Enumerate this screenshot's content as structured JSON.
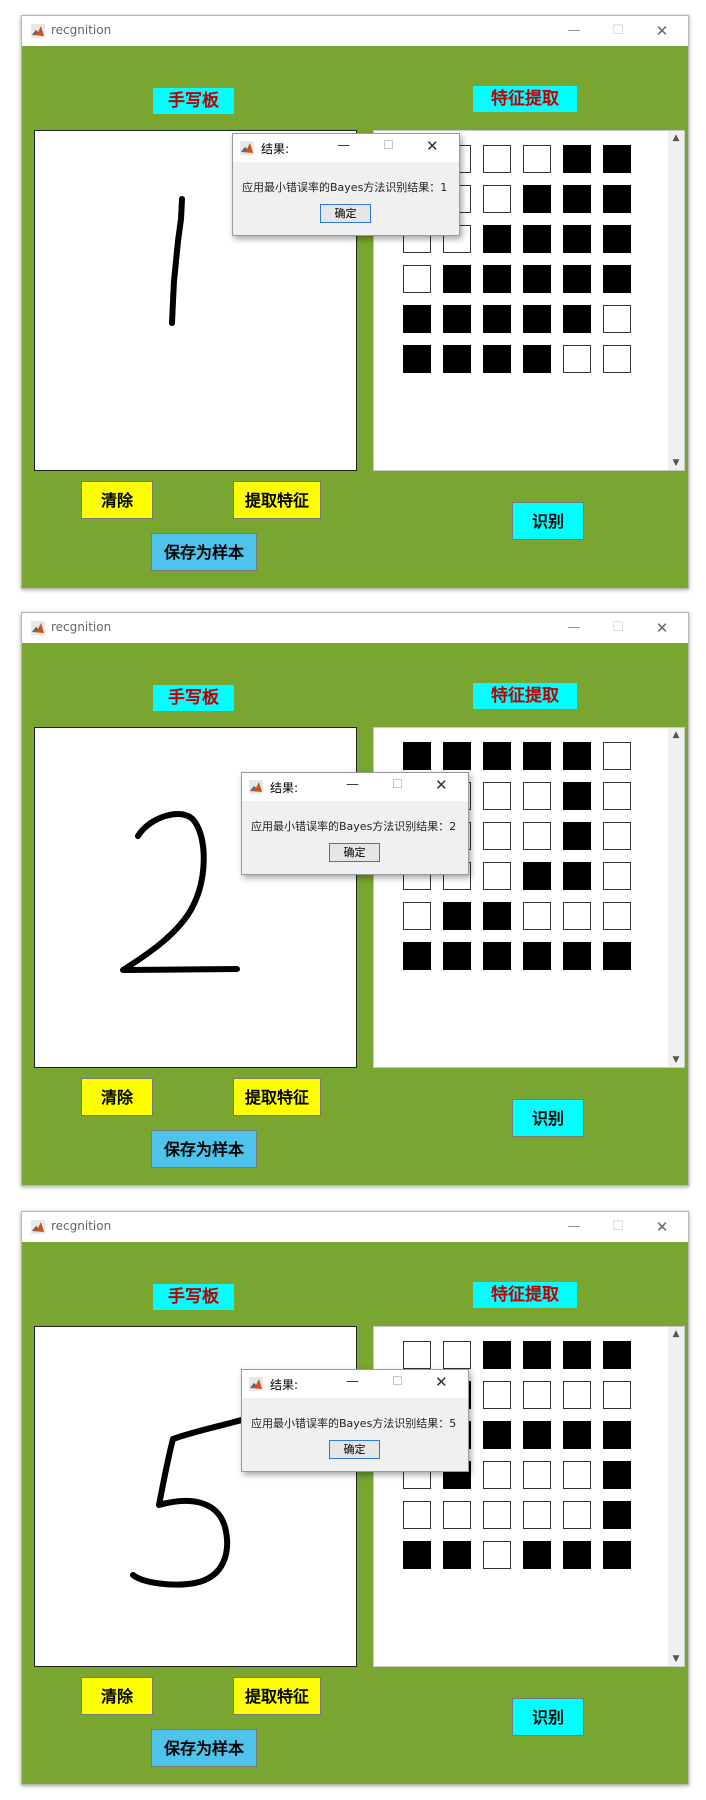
{
  "windows": [
    {
      "title": "recgnition",
      "handwriting_label": "手写板",
      "feature_label": "特征提取",
      "buttons": {
        "clear": "清除",
        "extract": "提取特征",
        "save": "保存为样本",
        "recognize": "识别"
      },
      "dialog": {
        "title": "结果:",
        "message": "应用最小错误率的Bayes方法识别结果：1",
        "ok": "确定"
      },
      "digit": "1",
      "features": [
        [
          0,
          0,
          0,
          0,
          1,
          1
        ],
        [
          0,
          0,
          0,
          1,
          1,
          1
        ],
        [
          0,
          0,
          1,
          1,
          1,
          1
        ],
        [
          0,
          1,
          1,
          1,
          1,
          1
        ],
        [
          1,
          1,
          1,
          1,
          1,
          0
        ],
        [
          1,
          1,
          1,
          1,
          0,
          0
        ]
      ]
    },
    {
      "title": "recgnition",
      "handwriting_label": "手写板",
      "feature_label": "特征提取",
      "buttons": {
        "clear": "清除",
        "extract": "提取特征",
        "save": "保存为样本",
        "recognize": "识别"
      },
      "dialog": {
        "title": "结果:",
        "message": "应用最小错误率的Bayes方法识别结果：2",
        "ok": "确定"
      },
      "digit": "2",
      "features": [
        [
          1,
          1,
          1,
          1,
          1,
          0
        ],
        [
          0,
          0,
          0,
          0,
          1,
          0
        ],
        [
          0,
          0,
          0,
          0,
          1,
          0
        ],
        [
          0,
          0,
          0,
          1,
          1,
          0
        ],
        [
          0,
          1,
          1,
          0,
          0,
          0
        ],
        [
          1,
          1,
          1,
          1,
          1,
          1
        ]
      ]
    },
    {
      "title": "recgnition",
      "handwriting_label": "手写板",
      "feature_label": "特征提取",
      "buttons": {
        "clear": "清除",
        "extract": "提取特征",
        "save": "保存为样本",
        "recognize": "识别"
      },
      "dialog": {
        "title": "结果:",
        "message": "应用最小错误率的Bayes方法识别结果：5",
        "ok": "确定"
      },
      "digit": "5",
      "features": [
        [
          0,
          0,
          1,
          1,
          1,
          1
        ],
        [
          0,
          1,
          0,
          0,
          0,
          0
        ],
        [
          1,
          1,
          1,
          1,
          1,
          1
        ],
        [
          0,
          1,
          0,
          0,
          0,
          1
        ],
        [
          0,
          0,
          0,
          0,
          0,
          1
        ],
        [
          1,
          1,
          0,
          1,
          1,
          1
        ]
      ]
    }
  ]
}
